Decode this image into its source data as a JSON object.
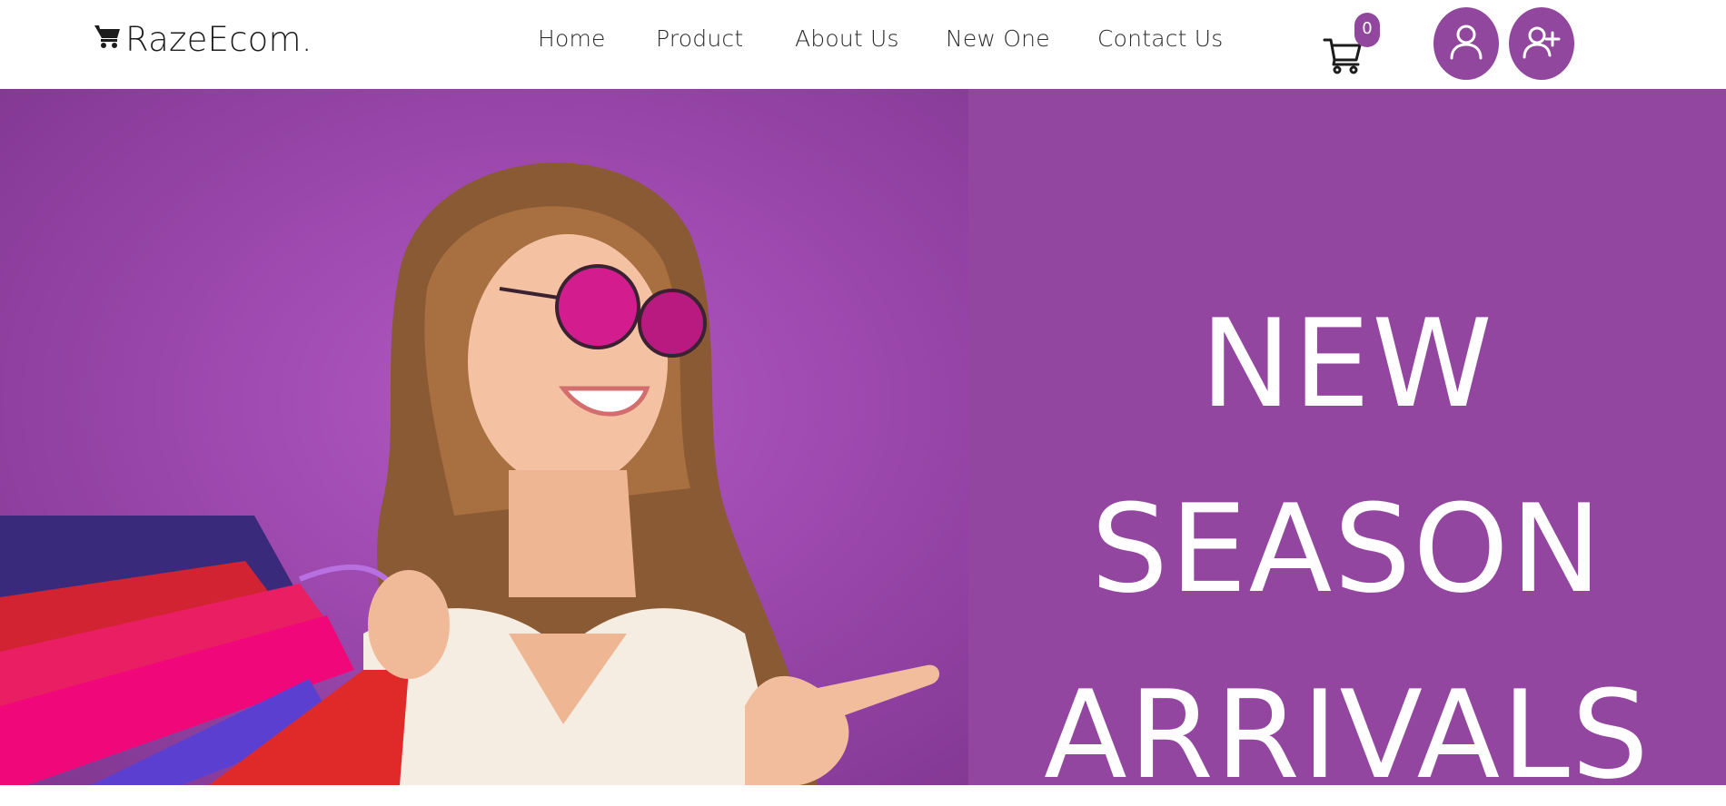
{
  "brand": {
    "name": "RazeEcom.",
    "icon": "cart-icon"
  },
  "nav": {
    "items": [
      {
        "label": "Home"
      },
      {
        "label": "Product"
      },
      {
        "label": "About Us"
      },
      {
        "label": "New One"
      },
      {
        "label": "Contact Us"
      }
    ]
  },
  "cart": {
    "icon": "cart-icon",
    "count": "0"
  },
  "account": {
    "login_icon": "user-icon",
    "register_icon": "user-plus-icon"
  },
  "hero": {
    "lines": [
      "NEW",
      "SEASON",
      "ARRIVALS"
    ],
    "image": "woman-with-shopping-bags-photo"
  },
  "colors": {
    "accent": "#92479e",
    "hero_background": "#93469f",
    "header_background": "#ffffff",
    "text_dark": "#1c1c1c",
    "text_light": "#ffffff"
  }
}
